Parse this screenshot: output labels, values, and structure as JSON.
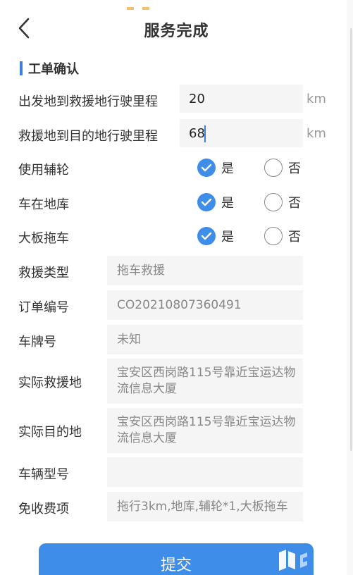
{
  "header": {
    "title": "服务完成",
    "back_icon": "chevron-left-icon"
  },
  "section": {
    "title": "工单确认"
  },
  "mileage": {
    "start_to_rescue": {
      "label": "出发地到救援地行驶里程",
      "value": "20",
      "unit": "km"
    },
    "rescue_to_destination": {
      "label": "救援地到目的地行驶里程",
      "value": "68",
      "unit": "km"
    }
  },
  "options": [
    {
      "label": "使用辅轮",
      "yes": "是",
      "no": "否",
      "selected": "yes"
    },
    {
      "label": "车在地库",
      "yes": "是",
      "no": "否",
      "selected": "yes"
    },
    {
      "label": "大板拖车",
      "yes": "是",
      "no": "否",
      "selected": "yes"
    }
  ],
  "details": {
    "rescue_type": {
      "label": "救援类型",
      "value": "拖车救援"
    },
    "order_number": {
      "label": "订单编号",
      "value": "CO20210807360491"
    },
    "plate_number": {
      "label": "车牌号",
      "value": "未知"
    },
    "actual_rescue_location": {
      "label": "实际救援地",
      "value": "宝安区西岗路115号靠近宝运达物流信息大厦"
    },
    "actual_destination": {
      "label": "实际目的地",
      "value": "宝安区西岗路115号靠近宝运达物流信息大厦"
    },
    "vehicle_model": {
      "label": "车辆型号",
      "value": ""
    },
    "free_items": {
      "label": "免收费项",
      "value": "拖行3km,地库,辅轮*1,大板拖车"
    }
  },
  "submit": {
    "label": "提交"
  },
  "colors": {
    "accent": "#3e8de8",
    "section_bar": "#3e7ee0",
    "field_bg": "#f5f5f5",
    "text": "#333333",
    "muted": "#888888"
  }
}
